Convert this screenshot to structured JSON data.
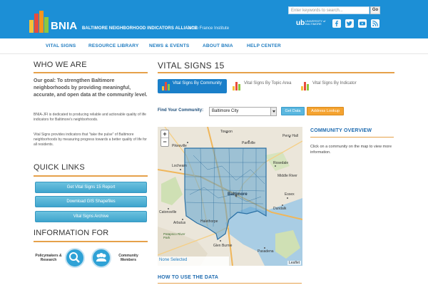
{
  "header": {
    "logo_text": "BNIA",
    "alliance": "BALTIMORE NEIGHBORHOOD INDICATORS ALLIANCE",
    "institute": "Jacob France Institute",
    "search_placeholder": "Enter keywords to search...",
    "search_button": "Go",
    "ub_logo": "ub",
    "ub_sub": "UNIVERSITY of BALTIMORE",
    "social": [
      "facebook-icon",
      "twitter-icon",
      "youtube-icon",
      "rss-icon"
    ]
  },
  "nav": [
    "VITAL SIGNS",
    "RESOURCE LIBRARY",
    "NEWS & EVENTS",
    "ABOUT BNIA",
    "HELP CENTER"
  ],
  "left": {
    "who_title": "WHO WE ARE",
    "goal": "Our goal: To strengthen Baltimore neighborhoods by providing meaningful, accurate, and open data at the community level.",
    "para1": "BNIA-JFI is dedicated to producing reliable and actionable quality of life indicators for Baltimore's neighborhoods.",
    "para2": "Vital Signs provides indicators that \"take the pulse\" of Baltimore neighborhoods by measuring progress towards a better quality of life for all residents.",
    "quick_title": "QUICK LINKS",
    "quick_links": [
      "Get Vital Signs 15 Report",
      "Download GIS Shapefiles",
      "Vital Signs Archive"
    ],
    "info_title": "INFORMATION FOR",
    "info_items": [
      "Policymakers & Research",
      "Community Members"
    ]
  },
  "main": {
    "title": "VITAL SIGNS 15",
    "tabs": [
      "Vital Signs By Community",
      "Vital Signs By Topic Area",
      "Vital Signs By Indicator"
    ],
    "find_label": "Find Your Community:",
    "community_value": "Baltimore City",
    "get_data": "Get Data",
    "address_lookup": "Address Lookup",
    "map_none_selected": "None Selected",
    "map_attribution": "Leaflet",
    "overview_title": "COMMUNITY OVERVIEW",
    "overview_text": "Click on a community on the map to view more information.",
    "how_title": "HOW TO USE THE DATA",
    "map_labels": [
      "Towson",
      "Perry Hall",
      "Parkville",
      "Pikesville",
      "Lochearn",
      "Rosedale",
      "Essex",
      "Baltimore",
      "Dundalk",
      "Catonsville",
      "Arbutus",
      "Halethorpe",
      "Glen Burnie",
      "Pasadena",
      "Middle River",
      "Patapsco River Park"
    ]
  },
  "colors": {
    "header_blue": "#1c8fd6",
    "accent_orange": "#e6a14a",
    "link_blue": "#1e7bc0",
    "button_teal": "#4eb1d8",
    "address_orange": "#f5a330"
  }
}
